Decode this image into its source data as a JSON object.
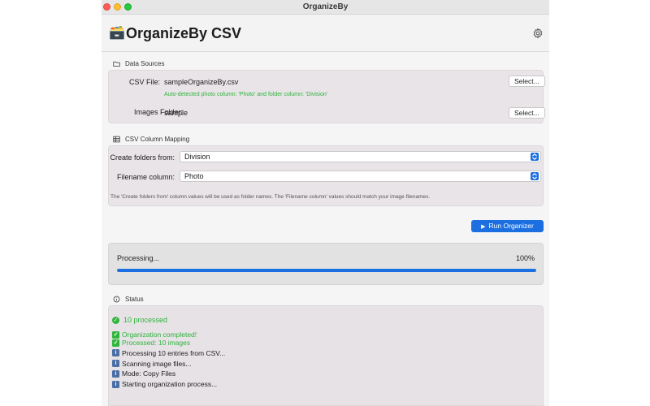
{
  "window": {
    "title": "OrganizeBy"
  },
  "header": {
    "icon": "🗃️",
    "title": "OrganizeBy CSV"
  },
  "data_sources": {
    "heading": "Data Sources",
    "csv_label": "CSV File:",
    "csv_value": "sampleOrganizeBy.csv",
    "detect_hint": "Auto-detected photo column: 'Photo' and folder column: 'Division'",
    "images_label": "Images Folder:",
    "images_value": "sample",
    "select_label": "Select..."
  },
  "mapping": {
    "heading": "CSV Column Mapping",
    "folders_label": "Create folders from:",
    "folders_value": "Division",
    "filename_label": "Filename column:",
    "filename_value": "Photo",
    "note": "The 'Create folders from' column values will be used as folder names. The 'Filename column' values should match your image filenames."
  },
  "run_button": {
    "label": "Run Organizer",
    "icon": "▶"
  },
  "progress": {
    "label": "Processing...",
    "percent_text": "100%",
    "value": 1.0
  },
  "status": {
    "heading": "Status",
    "summary": "10 processed",
    "log": [
      {
        "text": "Organization completed!",
        "kind": "success",
        "icon": "✓"
      },
      {
        "text": "Processed: 10 images",
        "kind": "success",
        "icon": "✓"
      },
      {
        "text": "Processing 10 entries from CSV...",
        "kind": "info",
        "icon": "i"
      },
      {
        "text": "Scanning image files...",
        "kind": "info",
        "icon": "i"
      },
      {
        "text": "Mode: Copy Files",
        "kind": "info",
        "icon": "i"
      },
      {
        "text": "Starting organization process...",
        "kind": "info",
        "icon": "i"
      }
    ]
  },
  "colors": {
    "accent": "#1b6fe0",
    "success": "#2fb53b"
  }
}
